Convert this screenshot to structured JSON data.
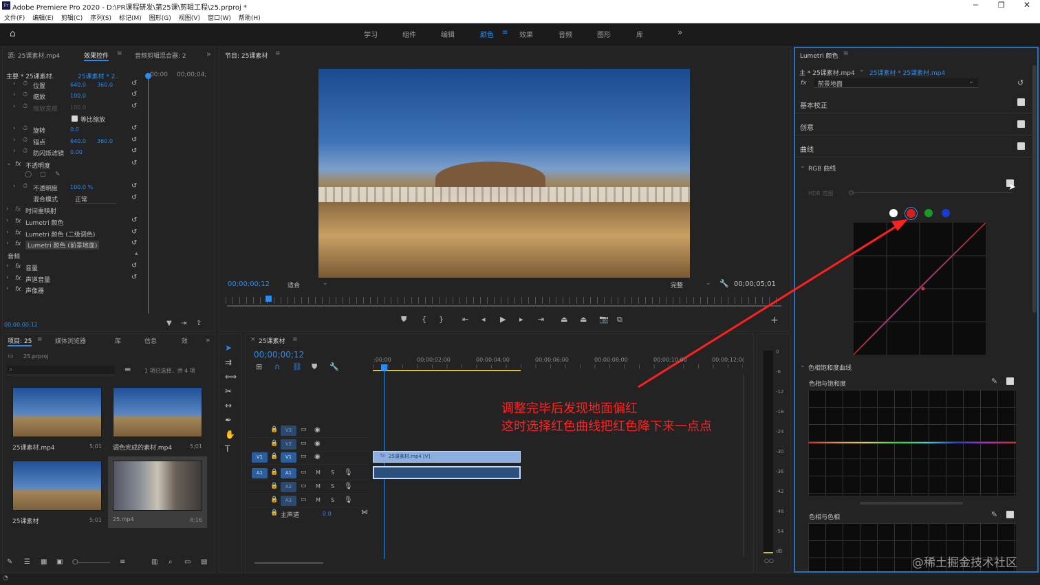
{
  "app": {
    "title": "Adobe Premiere Pro 2020 - D:\\PR课程研发\\第25课\\剪辑工程\\25.prproj *",
    "logo": "Pr"
  },
  "menu": [
    "文件(F)",
    "编辑(E)",
    "剪辑(C)",
    "序列(S)",
    "标记(M)",
    "图形(G)",
    "视图(V)",
    "窗口(W)",
    "帮助(H)"
  ],
  "workspaces": [
    "学习",
    "组件",
    "编辑",
    "颜色",
    "效果",
    "音频",
    "图形",
    "库"
  ],
  "effects": {
    "tabs": [
      "源: 25课素材.mp4",
      "效果控件",
      "音频剪辑混合器: 2"
    ],
    "master": "主要 * 25课素材.",
    "seq": "25课素材 * 2..",
    "t0": "00:00",
    "t1": "00;00;04;",
    "rows": [
      {
        "label": "位置",
        "v1": "640.0",
        "v2": "360.0"
      },
      {
        "label": "缩放",
        "v1": "100.0",
        "v2": ""
      },
      {
        "label": "缩放宽度",
        "v1": "100.0",
        "v2": ""
      },
      {
        "label": "等比缩放",
        "v1": "",
        "v2": ""
      },
      {
        "label": "旋转",
        "v1": "0.0",
        "v2": ""
      },
      {
        "label": "锚点",
        "v1": "640.0",
        "v2": "360.0"
      },
      {
        "label": "防闪烁滤镜",
        "v1": "0.00",
        "v2": ""
      }
    ],
    "opacity": "不透明度",
    "opacity_row": {
      "label": "不透明度",
      "v": "100.0 %"
    },
    "blend": {
      "label": "混合模式",
      "v": "正常"
    },
    "time_remap": "时间重映射",
    "lumetri": [
      "Lumetri 颜色",
      "Lumetri 颜色 (二级调色)",
      "Lumetri 颜色 (前景地面)"
    ],
    "audio": "音频",
    "audio_rows": [
      "音量",
      "声道音量",
      "声像器"
    ],
    "timecode": "00;00;00;12"
  },
  "program": {
    "title": "节目: 25课素材",
    "timecode": "00;00;00;12",
    "fit": "适合",
    "quality": "完整",
    "duration": "00;00;05;01"
  },
  "lumetri": {
    "title": "Lumetri 颜色",
    "master": "主 * 25课素材.mp4",
    "seq": "25课素材 * 25课素材.mp4",
    "preset": "前景地面",
    "sections": [
      "基本校正",
      "创意",
      "曲线"
    ],
    "rgb": "RGB 曲线",
    "hdr": "HDR 范围",
    "hue_sat": "色相饱和度曲线",
    "hue_vs_sat": "色相与饱和度",
    "hue_vs_hue": "色相与色相"
  },
  "project": {
    "tabs": [
      "项目: 25",
      "媒体浏览器",
      "库",
      "信息",
      "效"
    ],
    "file": "25.prproj",
    "status": "1 项已选择，共 4 项",
    "items": [
      {
        "name": "25课素材.mp4",
        "dur": "5;01"
      },
      {
        "name": "调色完成的素材.mp4",
        "dur": "5;01"
      },
      {
        "name": "25课素材",
        "dur": "5;01"
      },
      {
        "name": "25.mp4",
        "dur": "8;16"
      }
    ]
  },
  "timeline": {
    "title": "25课素材",
    "timecode": "00;00;00;12",
    "ruler": [
      ":00;00",
      "00;00;02;00",
      "00;00;04;00",
      "00;00;06;00",
      "00;00;08;00",
      "00;00;10;00",
      "00;00;12;0("
    ],
    "tracks": [
      "V3",
      "V2",
      "V1",
      "A1",
      "A2",
      "A3"
    ],
    "master": "主声道",
    "master_val": "0.0",
    "clip": "25课素材.mp4 [V]"
  },
  "meter": [
    "0",
    "-6",
    "-12",
    "-18",
    "-24",
    "-30",
    "-36",
    "-42",
    "-48",
    "-54",
    "dB"
  ],
  "annotation": [
    "调整完毕后发现地面偏红",
    "这时选择红色曲线把红色降下来一点点"
  ],
  "watermark": "@稀土掘金技术社区",
  "colors": {
    "accent": "#2d8ceb",
    "annotation": "#ff2222",
    "bg": "#232323"
  }
}
